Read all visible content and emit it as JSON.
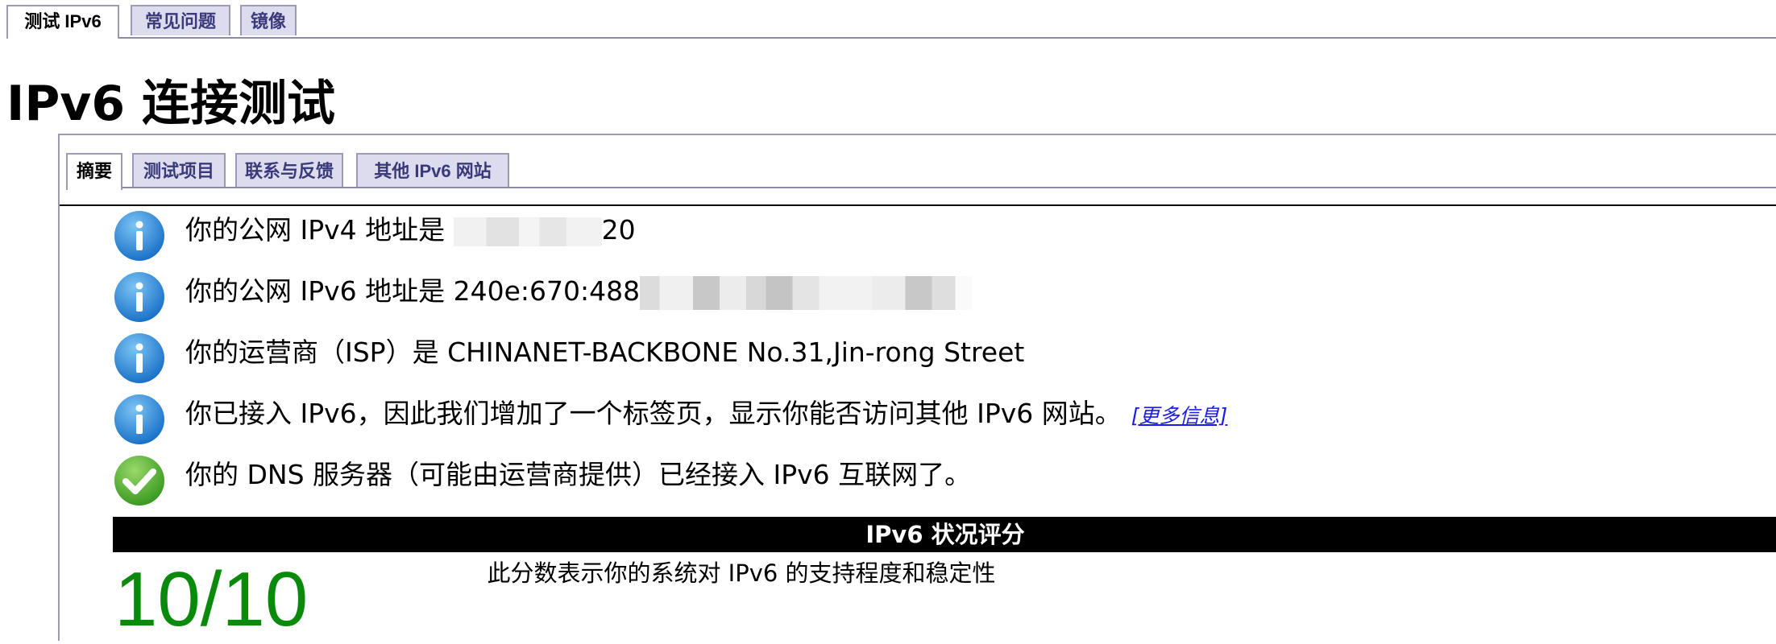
{
  "top_tabs": [
    {
      "label": "测试 IPv6",
      "active": true
    },
    {
      "label": "常见问题",
      "active": false
    },
    {
      "label": "镜像",
      "active": false
    }
  ],
  "page_title": "IPv6 连接测试",
  "inner_tabs": [
    {
      "label": "摘要",
      "active": true
    },
    {
      "label": "测试项目",
      "active": false
    },
    {
      "label": "联系与反馈",
      "active": false
    },
    {
      "label": "其他 IPv6 网站",
      "active": false
    }
  ],
  "results": [
    {
      "icon": "info-icon",
      "text": "你的公网 IPv4 地址是 ",
      "suffix": "20"
    },
    {
      "icon": "info-icon",
      "text": "你的公网 IPv6 地址是 240e:670:488"
    },
    {
      "icon": "info-icon",
      "text": "你的运营商（ISP）是 CHINANET-BACKBONE No.31,Jin-rong Street"
    },
    {
      "icon": "info-icon",
      "text": "你已接入 IPv6，因此我们增加了一个标签页，显示你能否访问其他 IPv6 网站。",
      "link": "[更多信息]"
    },
    {
      "icon": "check-icon",
      "text": "你的 DNS 服务器（可能由运营商提供）已经接入 IPv6 互联网了。"
    }
  ],
  "score": {
    "heading": "IPv6 状况评分",
    "description": "此分数表示你的系统对 IPv6 的支持程度和稳定性",
    "value": "10/10"
  },
  "colors": {
    "tab_bg": "#dcdcee",
    "tab_text": "#3a3a7a",
    "info_blue": "#2a8ad8",
    "check_green": "#4aa832",
    "score_green": "#0a8a0a",
    "link_blue": "#1a1aee"
  }
}
